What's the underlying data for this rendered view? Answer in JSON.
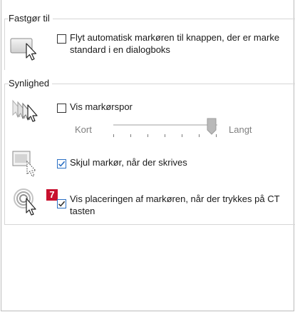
{
  "sections": {
    "fastgor": {
      "title": "Fastgør til",
      "snap_to": {
        "checked": false,
        "line1": "Flyt automatisk markøren til knappen, der er marke",
        "line2": "standard i en dialogboks"
      }
    },
    "synlighed": {
      "title": "Synlighed",
      "trails": {
        "checked": false,
        "label": "Vis markørspor",
        "slider_min_label": "Kort",
        "slider_max_label": "Langt",
        "slider_value": 0.95
      },
      "hide_while_typing": {
        "checked": true,
        "label": "Skjul markør, når der skrives"
      },
      "show_location": {
        "checked": true,
        "badge": "7",
        "line1": "Vis placeringen af markøren, når der trykkes på CT",
        "line2": "tasten"
      }
    }
  },
  "icons": {
    "snap": "snap-to-pointer-icon",
    "trails": "pointer-trails-icon",
    "hide": "hide-pointer-icon",
    "locate": "locate-pointer-icon"
  },
  "colors": {
    "check_accent": "#2a6fc4",
    "badge": "#c8102e"
  }
}
